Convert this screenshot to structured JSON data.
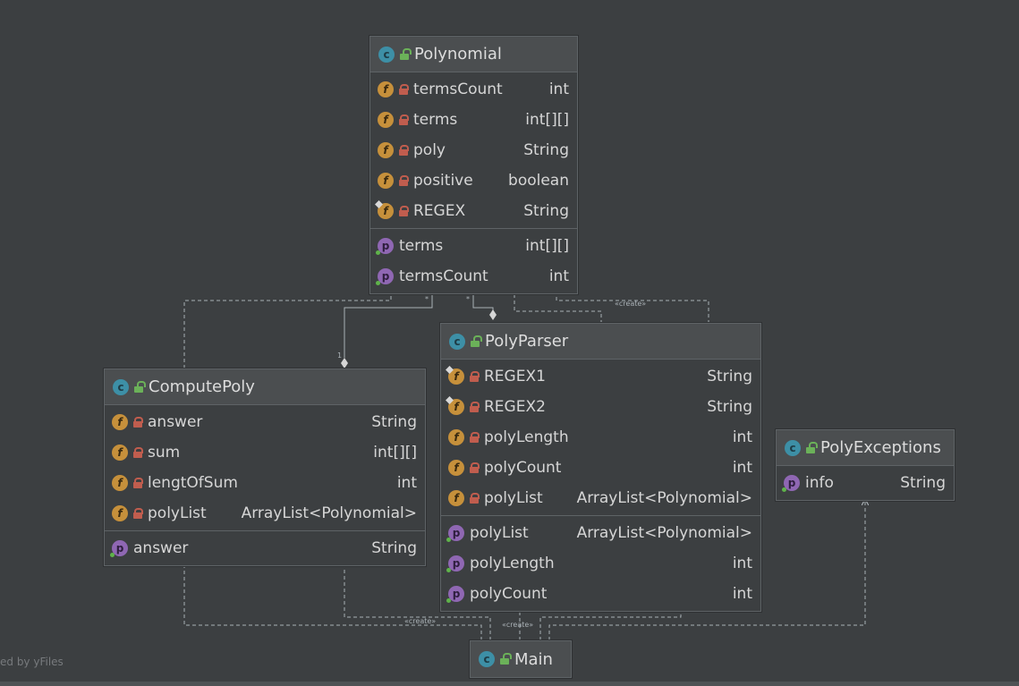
{
  "colors": {
    "background": "#3c3f41",
    "class_icon": "#3d8fa6",
    "field_icon": "#c6903b",
    "property_icon": "#8f67b3",
    "private_lock": "#c05d4e",
    "public_lock": "#6bb159"
  },
  "classes": {
    "polynomial": {
      "name": "Polynomial",
      "fields": [
        {
          "name": "termsCount",
          "type": "int",
          "icon": "field-icon",
          "static": false
        },
        {
          "name": "terms",
          "type": "int[][]",
          "icon": "field-icon",
          "static": false
        },
        {
          "name": "poly",
          "type": "String",
          "icon": "field-icon",
          "static": false
        },
        {
          "name": "positive",
          "type": "boolean",
          "icon": "field-icon",
          "static": false
        },
        {
          "name": "REGEX",
          "type": "String",
          "icon": "field-icon",
          "static": true
        }
      ],
      "properties": [
        {
          "name": "terms",
          "type": "int[][]",
          "icon": "property-icon"
        },
        {
          "name": "termsCount",
          "type": "int",
          "icon": "property-icon"
        }
      ]
    },
    "computepoly": {
      "name": "ComputePoly",
      "fields": [
        {
          "name": "answer",
          "type": "String",
          "icon": "field-icon",
          "static": false
        },
        {
          "name": "sum",
          "type": "int[][]",
          "icon": "field-icon",
          "static": false
        },
        {
          "name": "lengtOfSum",
          "type": "int",
          "icon": "field-icon",
          "static": false
        },
        {
          "name": "polyList",
          "type": "ArrayList<Polynomial>",
          "icon": "field-icon",
          "static": false
        }
      ],
      "properties": [
        {
          "name": "answer",
          "type": "String",
          "icon": "property-icon"
        }
      ]
    },
    "polyparser": {
      "name": "PolyParser",
      "fields": [
        {
          "name": "REGEX1",
          "type": "String",
          "icon": "field-icon",
          "static": true
        },
        {
          "name": "REGEX2",
          "type": "String",
          "icon": "field-icon",
          "static": true
        },
        {
          "name": "polyLength",
          "type": "int",
          "icon": "field-icon",
          "static": false
        },
        {
          "name": "polyCount",
          "type": "int",
          "icon": "field-icon",
          "static": false
        },
        {
          "name": "polyList",
          "type": "ArrayList<Polynomial>",
          "icon": "field-icon",
          "static": false
        }
      ],
      "properties": [
        {
          "name": "polyList",
          "type": "ArrayList<Polynomial>",
          "icon": "property-icon"
        },
        {
          "name": "polyLength",
          "type": "int",
          "icon": "property-icon"
        },
        {
          "name": "polyCount",
          "type": "int",
          "icon": "property-icon"
        }
      ]
    },
    "polyexceptions": {
      "name": "PolyExceptions",
      "fields": [],
      "properties": [
        {
          "name": "info",
          "type": "String",
          "icon": "property-icon"
        }
      ]
    },
    "main": {
      "name": "Main",
      "fields": [],
      "properties": []
    }
  },
  "edge_labels": {
    "create_1": "«create»",
    "create_2": "«create»",
    "create_3": "«create»",
    "mult_1": "1",
    "mult_star_1": "*",
    "mult_star_2": "*"
  },
  "watermark": "ed by yFiles"
}
